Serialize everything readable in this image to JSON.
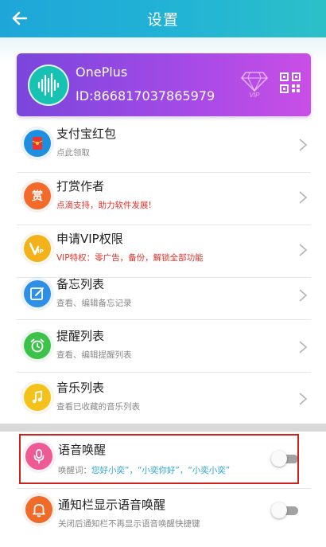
{
  "header": {
    "title": "设置"
  },
  "profile": {
    "name": "OnePlus",
    "id": "ID:866817037865979",
    "vip_badge_text": "VIP"
  },
  "rows": [
    {
      "title": "支付宝红包",
      "subtitle": "点此领取",
      "icon": "alipay-hongbao-icon",
      "color": "#1e8fe0"
    },
    {
      "title": "打赏作者",
      "subtitle": "点滴支持，助力软件发展!",
      "icon": "reward-icon",
      "color": "#f26b2a"
    },
    {
      "title": "申请VIP权限",
      "subtitle": "VIP特权：零广告，备份，解锁全部功能",
      "icon": "vip-icon",
      "color": "#f3b21b"
    },
    {
      "title": "备忘列表",
      "subtitle": "查看、编辑备忘记录",
      "icon": "memo-edit-icon",
      "color": "#2f8ee6"
    },
    {
      "title": "提醒列表",
      "subtitle": "查看、编辑提醒列表",
      "icon": "alarm-clock-icon",
      "color": "#3cc24a"
    },
    {
      "title": "音乐列表",
      "subtitle": "查看已收藏的音乐列表",
      "icon": "music-note-icon",
      "color": "#f5c21b"
    }
  ],
  "voice_wake": {
    "title": "语音唤醒",
    "label": "唤醒词：",
    "keywords": "您好小奕”，“小奕你好”，“小奕小奕”",
    "enabled": false,
    "icon": "microphone-icon",
    "color": "#ee5a94"
  },
  "notify_bar": {
    "title": "通知栏显示语音唤醒",
    "subtitle": "关闭后通知栏不再显示语音唤醒快捷键",
    "enabled": false,
    "icon": "bell-icon",
    "color": "#f06a2a"
  }
}
